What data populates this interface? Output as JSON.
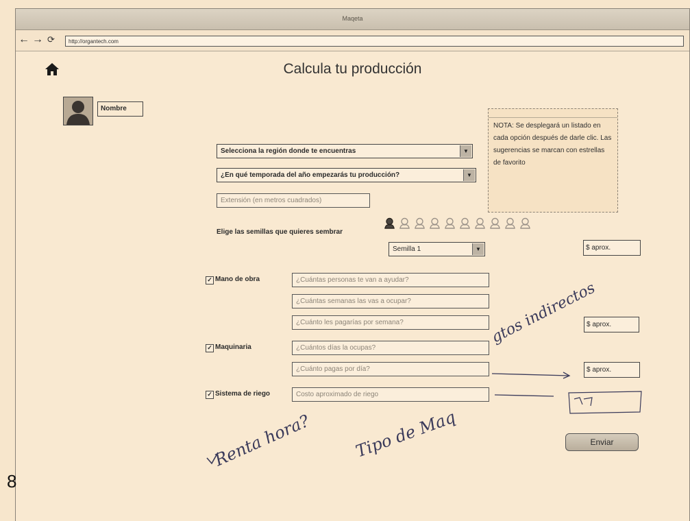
{
  "browser": {
    "title": "Maqeta",
    "url": "http://organtech.com",
    "back": "←",
    "forward": "→",
    "reload": "⟳"
  },
  "page": {
    "title": "Calcula tu producción",
    "page_number": "8"
  },
  "user": {
    "name_label": "Nombre"
  },
  "form": {
    "region_select": "Selecciona la región donde te encuentras",
    "season_select": "¿En qué temporada del año empezarás tu producción?",
    "extension_placeholder": "Extensión (en metros cuadrados)",
    "seeds_label": "Elige las semillas que quieres sembrar",
    "seed_select": "Semilla 1",
    "aprox_label": "$ aprox.",
    "labor": {
      "label": "Mano de obra",
      "checked": true,
      "q1": "¿Cuántas personas te van a ayudar?",
      "q2": "¿Cuántas semanas las vas a ocupar?",
      "q3": "¿Cuánto les pagarías por semana?"
    },
    "machinery": {
      "label": "Maquinaria",
      "checked": true,
      "q1": "¿Cuántos días la ocupas?",
      "q2": "¿Cuánto pagas por día?"
    },
    "irrigation": {
      "label": "Sistema de riego",
      "checked": true,
      "q1": "Costo aproximado de riego"
    },
    "submit": "Enviar"
  },
  "note": {
    "text": "NOTA: Se desplegará un listado en cada opción después de darle clic. Las sugerencias se marcan con estrellas de favorito"
  },
  "seeds": {
    "count": 10,
    "highlighted": 1
  },
  "handwriting": {
    "side": "gtos indirectos",
    "bottom_left": "Renta hora?",
    "bottom_mid": "Tipo de Maq"
  },
  "colors": {
    "paper": "#f7e6cc",
    "ink": "#3a3a5a"
  }
}
